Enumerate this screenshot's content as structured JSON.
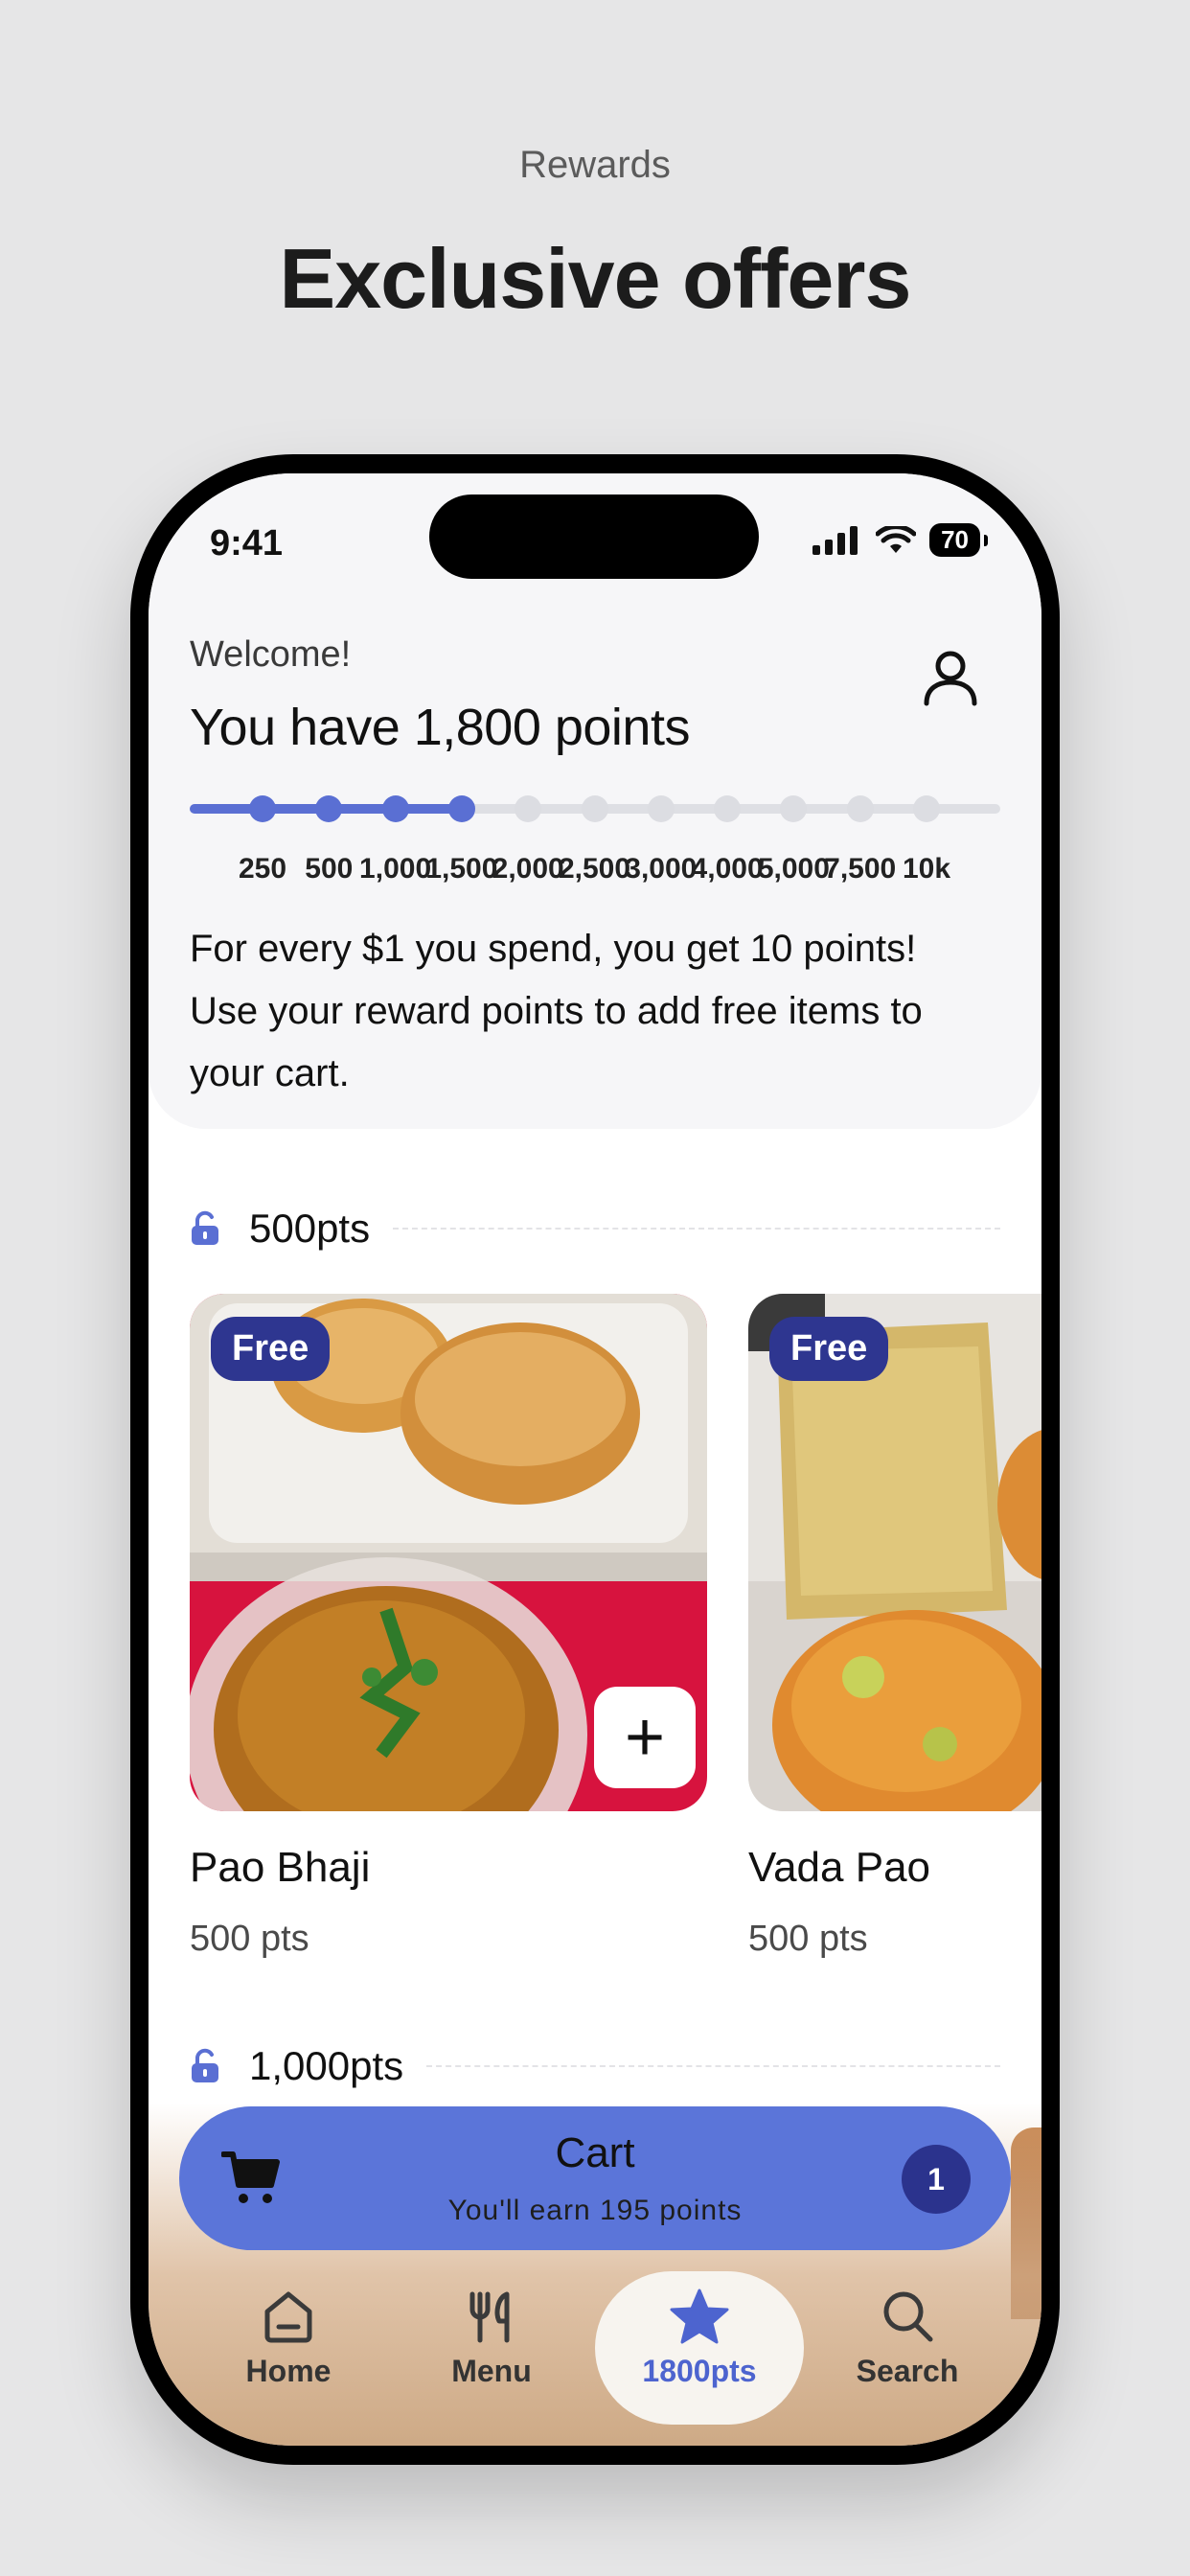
{
  "header": {
    "eyebrow": "Rewards",
    "title": "Exclusive offers"
  },
  "status_bar": {
    "time": "9:41",
    "battery": "70"
  },
  "rewards": {
    "welcome": "Welcome!",
    "points_title": "You have 1,800 points",
    "progress": {
      "current_points": 1800,
      "milestones": [
        "250",
        "500",
        "1,000",
        "1,500",
        "2,000",
        "2,500",
        "3,000",
        "4,000",
        "5,000",
        "7,500",
        "10k"
      ],
      "reached_count": 4
    },
    "description": "For every $1 you spend, you get 10 points! Use your reward points to add free items to your cart."
  },
  "tiers": [
    {
      "label": "500pts",
      "items": [
        {
          "badge": "Free",
          "name": "Pao Bhaji",
          "points": "500 pts",
          "add_label": "+"
        },
        {
          "badge": "Free",
          "name": "Vada Pao",
          "points": "500 pts"
        }
      ]
    },
    {
      "label": "1,000pts"
    }
  ],
  "cart": {
    "title": "Cart",
    "subtitle": "You'll earn 195 points",
    "count": "1"
  },
  "nav": [
    {
      "label": "Home",
      "icon": "home-icon"
    },
    {
      "label": "Menu",
      "icon": "utensils-icon"
    },
    {
      "label": "1800pts",
      "icon": "star-icon",
      "active": true
    },
    {
      "label": "Search",
      "icon": "search-icon"
    }
  ],
  "colors": {
    "accent": "#5a6fd3",
    "badge": "#2e3690",
    "cart_bar": "#5b75d9"
  }
}
